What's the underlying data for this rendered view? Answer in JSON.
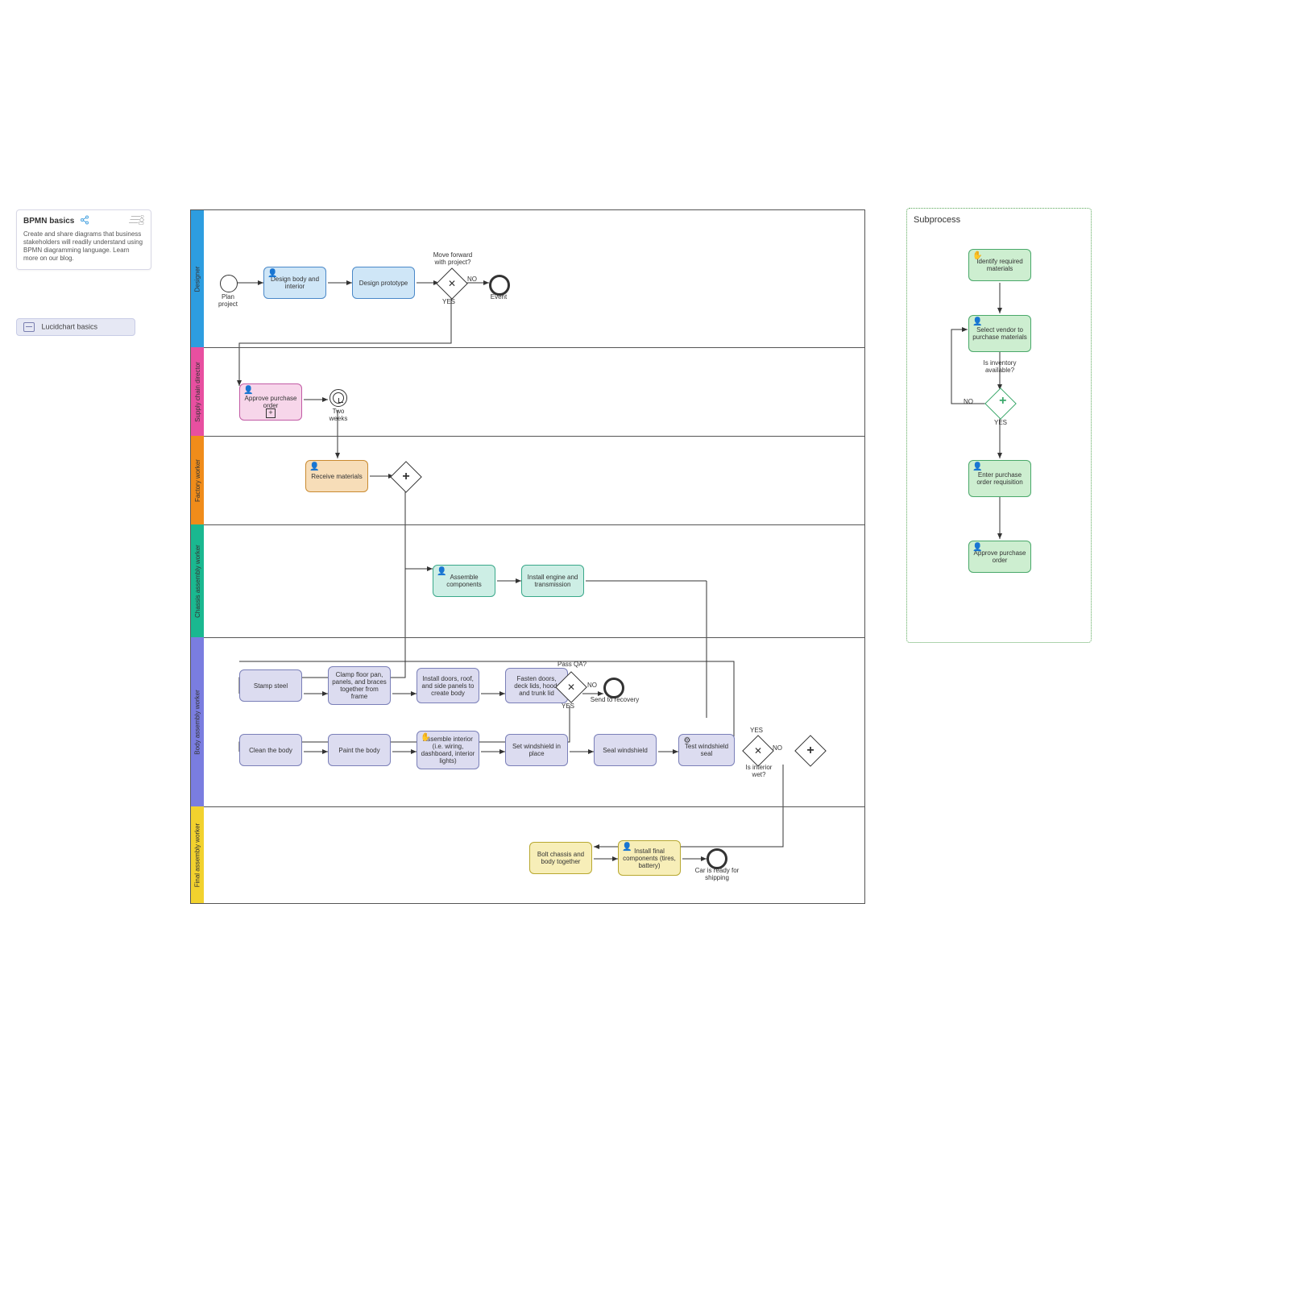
{
  "info_card": {
    "title": "BPMN basics",
    "description": "Create and share diagrams that business stakeholders will readily understand using BPMN diagramming language. Learn more on our blog."
  },
  "lucid_pill": {
    "label": "Lucidchart basics"
  },
  "lanes": {
    "designer": "Designer",
    "supply": "Supply chain director",
    "factory": "Factory worker",
    "chassis": "Chassis assembly worker",
    "body": "Body assembly worker",
    "final": "Final assembly worker"
  },
  "events": {
    "plan_project": "Plan\nproject",
    "end_event": "Event",
    "two_weeks": "Two\nweeks",
    "send_to_recovery": "Send to recovery",
    "car_ready": "Car is ready for\nshipping"
  },
  "gateways": {
    "move_forward": "Move forward\nwith project?",
    "no": "NO",
    "yes": "YES",
    "pass_qa": "Pass QA?",
    "interior_wet": "Is interior\nwet?",
    "inventory_available": "Is inventory\navailable?"
  },
  "tasks": {
    "design_body": "Design body and interior",
    "design_proto": "Design prototype",
    "approve_po": "Approve purchase order",
    "receive_mat": "Receive materials",
    "assemble_comp": "Assemble components",
    "install_engine": "Install engine and transmission",
    "stamp_steel": "Stamp steel",
    "clamp_floor": "Clamp floor pan, panels, and braces together from frame",
    "install_doors": "Install doors, roof, and side panels to create body",
    "fasten_doors": "Fasten doors, deck lids, hood, and trunk lid",
    "clean_body": "Clean the body",
    "paint_body": "Paint the body",
    "assemble_interior": "Assemble interior (i.e. wiring, dashboard, interior lights)",
    "set_windshield": "Set windshield in place",
    "seal_windshield": "Seal windshield",
    "test_windshield": "Test windshield seal",
    "bolt_chassis": "Bolt chassis and body together",
    "install_final": "Install final components (tires, battery)"
  },
  "subprocess": {
    "title": "Subprocess",
    "identify": "Identify required materials",
    "select_vendor": "Select vendor to purchase materials",
    "enter_por": "Enter purchase order requisition",
    "approve_po": "Approve purchase order"
  }
}
